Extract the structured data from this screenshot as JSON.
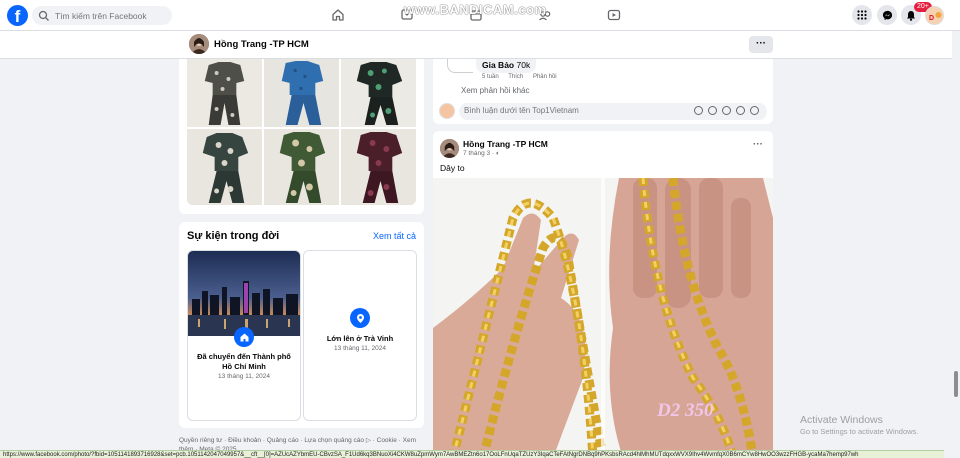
{
  "topnav": {
    "search_placeholder": "Tìm kiếm trên Facebook",
    "notification_count": "20+",
    "watermark": "www.BANDICAM.com"
  },
  "profile_header": {
    "name": "Hồng Trang -TP HCM"
  },
  "events": {
    "title": "Sự kiện trong đời",
    "see_all": "Xem tất cả",
    "items": [
      {
        "label": "Đã chuyển đến Thành phố Hồ Chí Minh",
        "date": "13 tháng 11, 2024",
        "icon": "home-icon"
      },
      {
        "label": "Lớn lên ở Trà Vinh",
        "date": "13 tháng 11, 2024",
        "icon": "location-pin-icon"
      }
    ]
  },
  "footer": {
    "links": "Quyền riêng tư · Điều khoản · Quảng cáo · Lựa chọn quảng cáo ▷ · Cookie · Xem thêm · Meta © 2025"
  },
  "comment": {
    "reply_author": "Gia Bảo",
    "reply_text": "70k",
    "reply_time": "5 tuần",
    "like": "Thích",
    "reply": "Phản hồi",
    "more_replies": "Xem phản hồi khác",
    "input_placeholder": "Bình luận dưới tên Top1Vietnam"
  },
  "post": {
    "author": "Hồng Trang -TP HCM",
    "time": "7 tháng 3 · ",
    "text": "Dây to",
    "image_watermark": "D2 350"
  },
  "windows": {
    "activate_title": "Activate Windows",
    "activate_sub": "Go to Settings to activate Windows."
  },
  "statusbar": {
    "url": "https://www.facebook.com/photo/?fbid=1051141893716928&set=pcb.1051142047049957&__cft__[0]=AZUcAZYbmEU-CBvzSA_F1Ud6kq3BNuoXi4CKW8uZpmWym7AwBMEZtn6o17OoLFnUqaTZUzY3IqaCTeFAtNgrDNBq9hPKsbsRAcd4hlMhMUTdqxxWVX9Ihv4WvmfqX0B6mCYw8HwOO3wzzFHGB-ycaMa7hemp97wh"
  },
  "colors": {
    "fb_blue": "#0866ff",
    "background": "#f0f2f5",
    "card": "#ffffff",
    "muted_text": "#65676b",
    "notification_red": "#e41e3f"
  }
}
